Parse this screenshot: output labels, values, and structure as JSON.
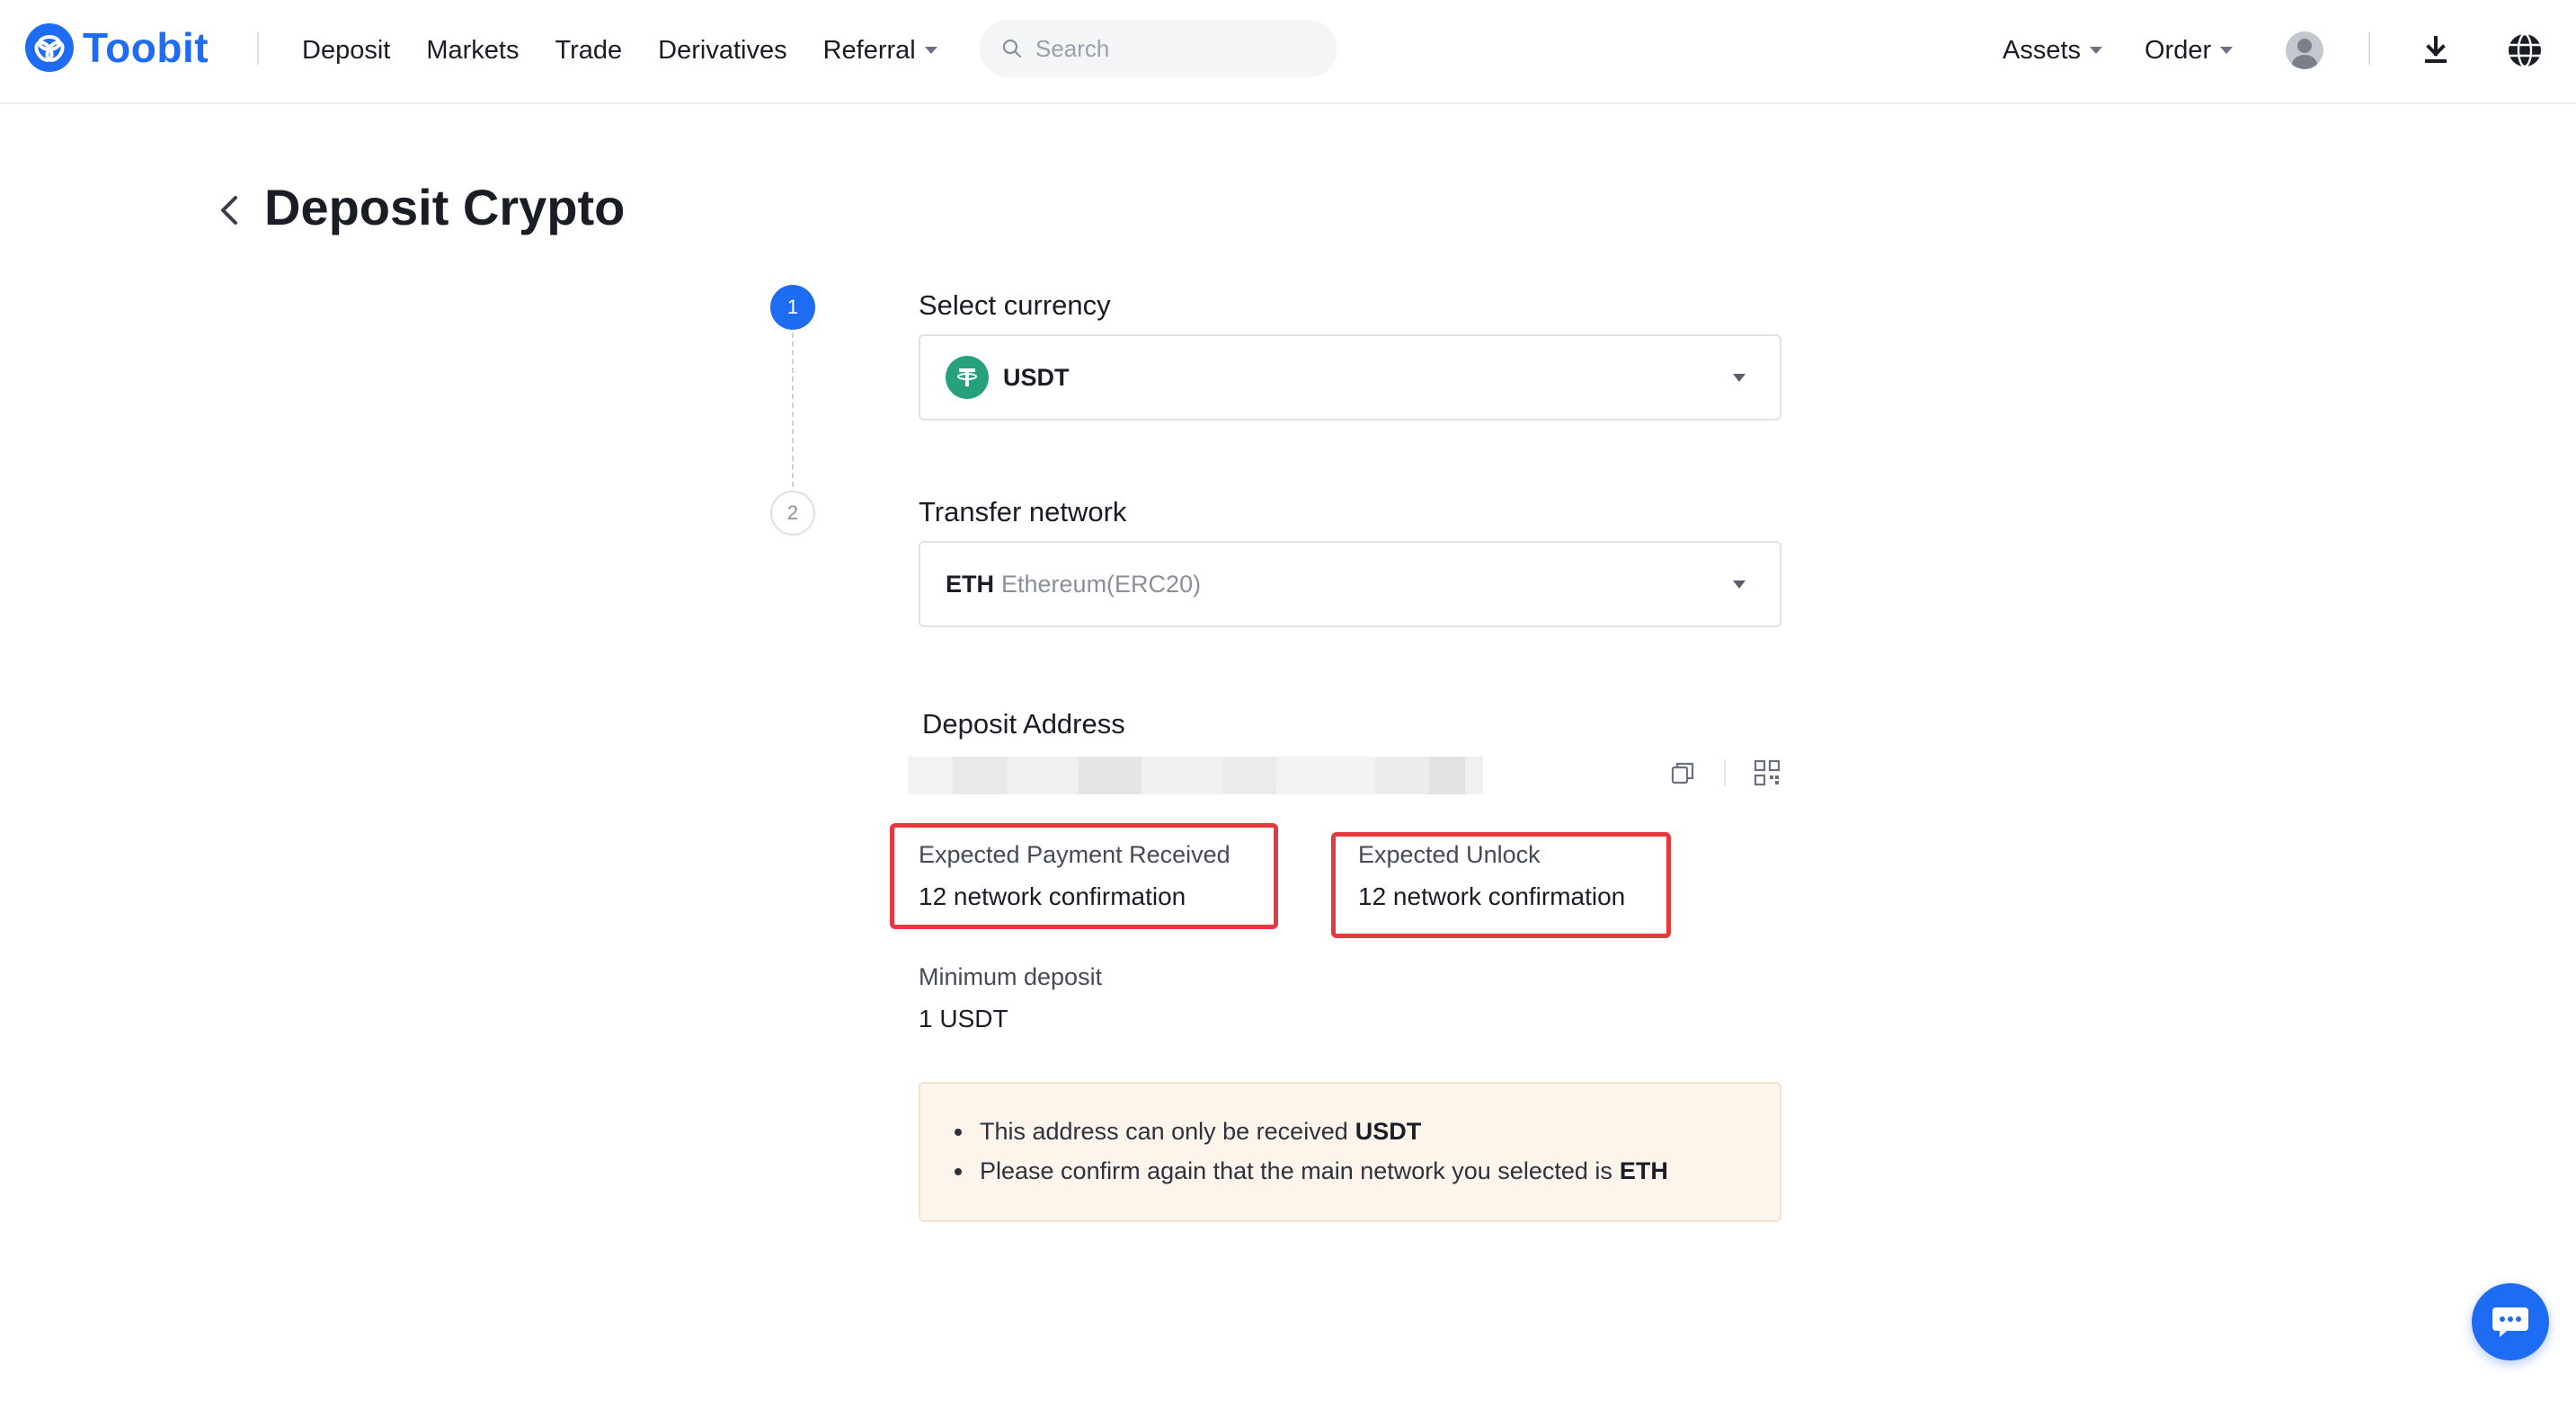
{
  "brand": {
    "name": "Toobit",
    "accent": "#1e6cf3"
  },
  "nav": {
    "items": [
      "Deposit",
      "Markets",
      "Trade",
      "Derivatives",
      "Referral"
    ]
  },
  "search": {
    "placeholder": "Search"
  },
  "header_right": {
    "assets": "Assets",
    "order": "Order"
  },
  "page": {
    "title": "Deposit Crypto"
  },
  "stepper": {
    "step1": "1",
    "step2": "2"
  },
  "currency": {
    "label": "Select currency",
    "selected": "USDT",
    "icon": "tether-icon",
    "icon_color": "#26a17b"
  },
  "network": {
    "label": "Transfer network",
    "code": "ETH",
    "name": "Ethereum(ERC20)"
  },
  "address": {
    "label": "Deposit Address"
  },
  "expected_payment": {
    "title": "Expected Payment Received",
    "value": "12 network confirmation",
    "highlight_color": "#e5393d"
  },
  "expected_unlock": {
    "title": "Expected Unlock",
    "value": "12 network confirmation"
  },
  "minimum": {
    "title": "Minimum deposit",
    "value": "1 USDT"
  },
  "notice": {
    "line1_text": "This address can only be received",
    "line1_bold": "USDT",
    "line2_text": "Please confirm again that the main network you selected is",
    "line2_bold": "ETH",
    "background": "#fdf5ec"
  }
}
